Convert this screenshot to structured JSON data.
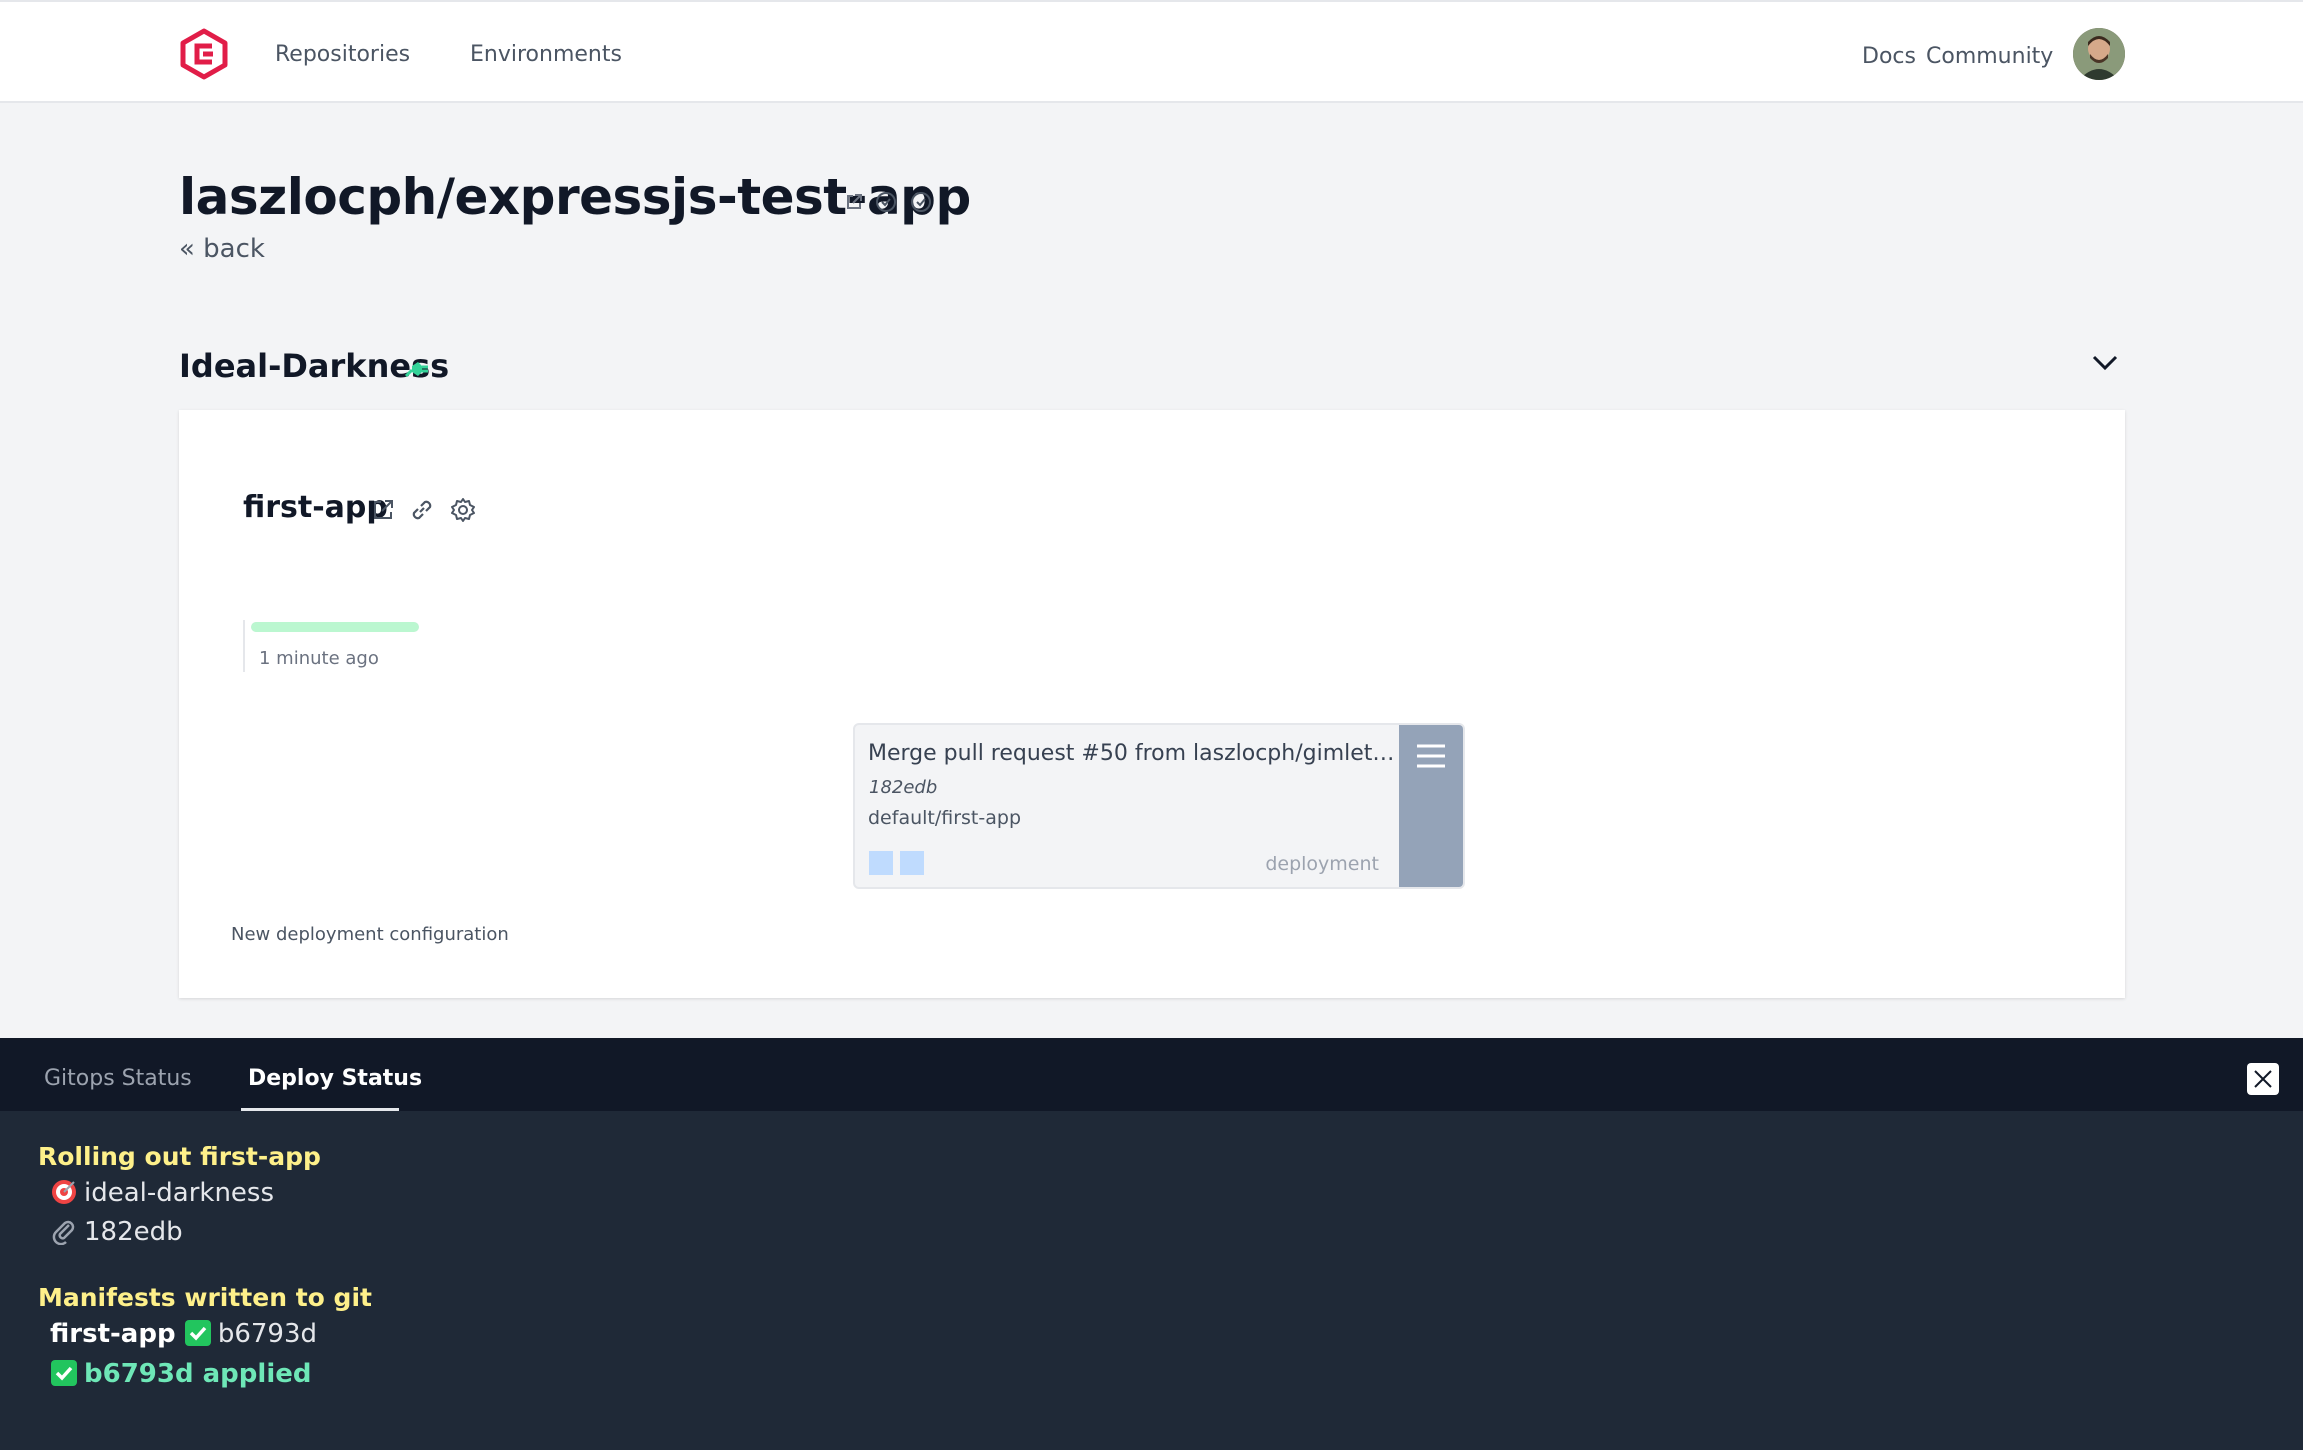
{
  "nav": {
    "repositories": "Repositories",
    "environments": "Environments",
    "docs": "Docs",
    "community": "Community"
  },
  "repo": {
    "title": "laszlocph/expressjs-test-app",
    "back": "« back"
  },
  "environment": {
    "name": "Ideal-Darkness"
  },
  "app": {
    "name": "first-app",
    "rollout_progress": 1.0,
    "time_ago": "1 minute ago",
    "deployment": {
      "message": "Merge pull request #50 from laszlocph/gimlet-co…",
      "sha": "182edb",
      "target": "default/first-app",
      "kind": "deployment",
      "pods": 2
    },
    "new_config": "New deployment configuration"
  },
  "panel": {
    "tabs": [
      "Gitops Status",
      "Deploy Status"
    ],
    "active_tab": "Deploy Status",
    "rolling_heading": "Rolling out first-app",
    "env_line": "ideal-darkness",
    "sha_line": "182edb",
    "manifests_heading": "Manifests written to git",
    "manifest_app": "first-app",
    "manifest_sha": "b6793d",
    "applied_line": "b6793d applied"
  },
  "colors": {
    "brand": "#e11d48",
    "success": "#34d399",
    "heading_yellow": "#fef08a",
    "panel_bg": "#1f2937"
  }
}
